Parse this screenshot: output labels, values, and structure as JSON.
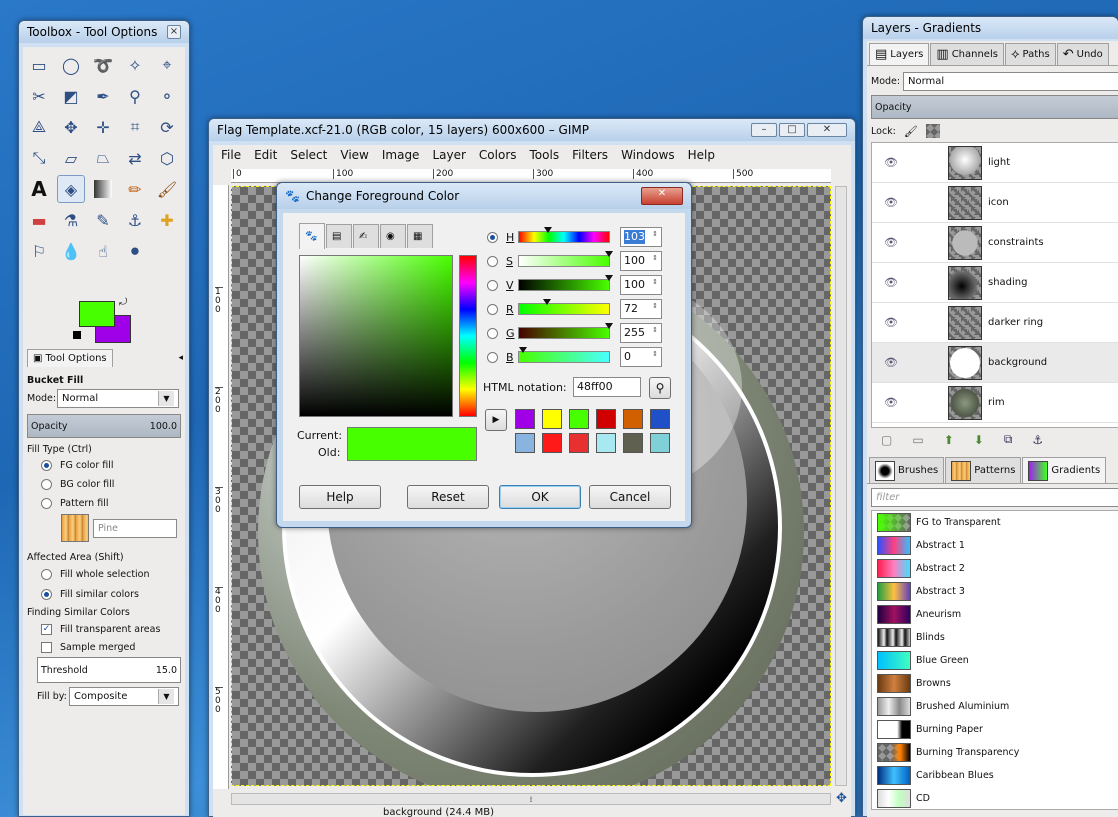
{
  "toolbox": {
    "title": "Toolbox - Tool Options",
    "close": "×",
    "tab_label": "Tool Options",
    "tool_name": "Bucket Fill",
    "mode_label": "Mode:",
    "mode_value": "Normal",
    "opacity_label": "Opacity",
    "opacity_value": "100.0",
    "fill_type_label": "Fill Type  (Ctrl)",
    "fill_fg": "FG color fill",
    "fill_bg": "BG color fill",
    "fill_pattern": "Pattern fill",
    "pattern_name": "Pine",
    "affected_label": "Affected Area  (Shift)",
    "affected_whole": "Fill whole selection",
    "affected_similar": "Fill similar colors",
    "finding_label": "Finding Similar Colors",
    "fill_transparent": "Fill transparent areas",
    "sample_merged": "Sample merged",
    "threshold_label": "Threshold",
    "threshold_value": "15.0",
    "fillby_label": "Fill by:",
    "fillby_value": "Composite",
    "fg_color": "#48ff00",
    "bg_color": "#a000e8"
  },
  "image_window": {
    "title": "Flag Template.xcf-21.0 (RGB color, 15 layers) 600x600 – GIMP",
    "menu": [
      "File",
      "Edit",
      "Select",
      "View",
      "Image",
      "Layer",
      "Colors",
      "Tools",
      "Filters",
      "Windows",
      "Help"
    ],
    "ruler_top": [
      "0",
      "100",
      "200",
      "300",
      "400",
      "500"
    ],
    "ruler_left": [
      "1\n0\n0",
      "2\n0\n0",
      "3\n0\n0",
      "4\n0\n0",
      "5\n0\n0"
    ],
    "status_text": "background (24.4 MB)"
  },
  "dialog": {
    "title": "Change Foreground Color",
    "channels": [
      {
        "key": "H",
        "value": "103"
      },
      {
        "key": "S",
        "value": "100"
      },
      {
        "key": "V",
        "value": "100"
      },
      {
        "key": "R",
        "value": "72"
      },
      {
        "key": "G",
        "value": "255"
      },
      {
        "key": "B",
        "value": "0"
      }
    ],
    "html_label": "HTML notation:",
    "html_value": "48ff00",
    "current_label": "Current:",
    "old_label": "Old:",
    "current_color": "#48ff00",
    "old_color": "#48ff00",
    "history": [
      "#a000e8",
      "#ffff00",
      "#48ff00",
      "#d00000",
      "#d06000",
      "#2050c8",
      "#8ab4e0",
      "#ff1a1a",
      "#e83030",
      "#a8e8f0",
      "#606050",
      "#80d0d8"
    ],
    "help": "Help",
    "reset": "Reset",
    "ok": "OK",
    "cancel": "Cancel"
  },
  "layers": {
    "title": "Layers - Gradients",
    "tabs": [
      "Layers",
      "Channels",
      "Paths",
      "Undo"
    ],
    "mode_label": "Mode:",
    "mode_value": "Normal",
    "opacity_label": "Opacity",
    "lock_label": "Lock:",
    "items": [
      "light",
      "icon",
      "constraints",
      "shading",
      "darker ring",
      "background",
      "rim"
    ],
    "selected": "background"
  },
  "gradients": {
    "tabs": [
      "Brushes",
      "Patterns",
      "Gradients"
    ],
    "filter_placeholder": "filter",
    "items": [
      {
        "name": "FG to Transparent",
        "css": "linear-gradient(90deg,#48ff00,rgba(72,255,0,0))"
      },
      {
        "name": "Abstract 1",
        "css": "linear-gradient(90deg,#3050ff,#ff4080,#30c0ff)"
      },
      {
        "name": "Abstract 2",
        "css": "linear-gradient(90deg,#ff2050,#ff80c0,#40e0ff)"
      },
      {
        "name": "Abstract 3",
        "css": "linear-gradient(90deg,#20a040,#ffc040,#6040c0)"
      },
      {
        "name": "Aneurism",
        "css": "linear-gradient(90deg,#200040,#a01060,#300060)"
      },
      {
        "name": "Blinds",
        "css": "repeating-linear-gradient(90deg,#111 0,#eee 6px,#111 9px)"
      },
      {
        "name": "Blue Green",
        "css": "linear-gradient(90deg,#00c0ff,#40ffc0)"
      },
      {
        "name": "Browns",
        "css": "linear-gradient(90deg,#6a3a10,#d08040,#6a3a10)"
      },
      {
        "name": "Brushed Aluminium",
        "css": "linear-gradient(90deg,#999,#eee,#888,#ddd)"
      },
      {
        "name": "Burning Paper",
        "css": "linear-gradient(90deg,#fff 60%,#000 75%)"
      },
      {
        "name": "Burning Transparency",
        "css": "linear-gradient(90deg,rgba(0,0,0,0) 40%,#ff8000 70%,#000)"
      },
      {
        "name": "Caribbean Blues",
        "css": "linear-gradient(90deg,#003080,#40c0ff,#0060c0)"
      },
      {
        "name": "CD",
        "css": "linear-gradient(90deg,#ddd,#fff,#c0ffc0,#ddd)"
      }
    ]
  }
}
